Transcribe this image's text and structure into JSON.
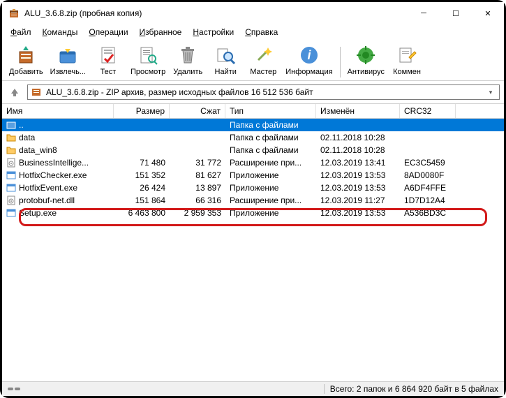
{
  "titlebar": {
    "title": "ALU_3.6.8.zip (пробная копия)"
  },
  "menubar": {
    "file": "Файл",
    "commands": "Команды",
    "operations": "Операции",
    "favorites": "Избранное",
    "settings": "Настройки",
    "help": "Справка"
  },
  "toolbar": {
    "add": "Добавить",
    "extract": "Извлечь...",
    "test": "Тест",
    "view": "Просмотр",
    "delete": "Удалить",
    "find": "Найти",
    "wizard": "Мастер",
    "info": "Информация",
    "antivirus": "Антивирус",
    "comment": "Коммен"
  },
  "address": {
    "text": "ALU_3.6.8.zip - ZIP архив, размер исходных файлов 16 512 536 байт"
  },
  "columns": {
    "name": "Имя",
    "size": "Размер",
    "packed": "Сжат",
    "type": "Тип",
    "modified": "Изменён",
    "crc": "CRC32"
  },
  "rows": [
    {
      "name": "..",
      "size": "",
      "packed": "",
      "type": "Папка с файлами",
      "modified": "",
      "crc": "",
      "icon": "up",
      "selected": true
    },
    {
      "name": "data",
      "size": "",
      "packed": "",
      "type": "Папка с файлами",
      "modified": "02.11.2018 10:28",
      "crc": "",
      "icon": "folder"
    },
    {
      "name": "data_win8",
      "size": "",
      "packed": "",
      "type": "Папка с файлами",
      "modified": "02.11.2018 10:28",
      "crc": "",
      "icon": "folder"
    },
    {
      "name": "BusinessIntellige...",
      "size": "71 480",
      "packed": "31 772",
      "type": "Расширение при...",
      "modified": "12.03.2019 13:41",
      "crc": "EC3C5459",
      "icon": "dll"
    },
    {
      "name": "HotfixChecker.exe",
      "size": "151 352",
      "packed": "81 627",
      "type": "Приложение",
      "modified": "12.03.2019 13:53",
      "crc": "8AD0080F",
      "icon": "exe"
    },
    {
      "name": "HotfixEvent.exe",
      "size": "26 424",
      "packed": "13 897",
      "type": "Приложение",
      "modified": "12.03.2019 13:53",
      "crc": "A6DF4FFE",
      "icon": "exe"
    },
    {
      "name": "protobuf-net.dll",
      "size": "151 864",
      "packed": "66 316",
      "type": "Расширение при...",
      "modified": "12.03.2019 11:27",
      "crc": "1D7D12A4",
      "icon": "dll"
    },
    {
      "name": "Setup.exe",
      "size": "6 463 800",
      "packed": "2 959 353",
      "type": "Приложение",
      "modified": "12.03.2019 13:53",
      "crc": "A536BD3C",
      "icon": "exe"
    }
  ],
  "statusbar": {
    "text": "Всего: 2 папок и 6 864 920 байт в 5 файлах"
  }
}
